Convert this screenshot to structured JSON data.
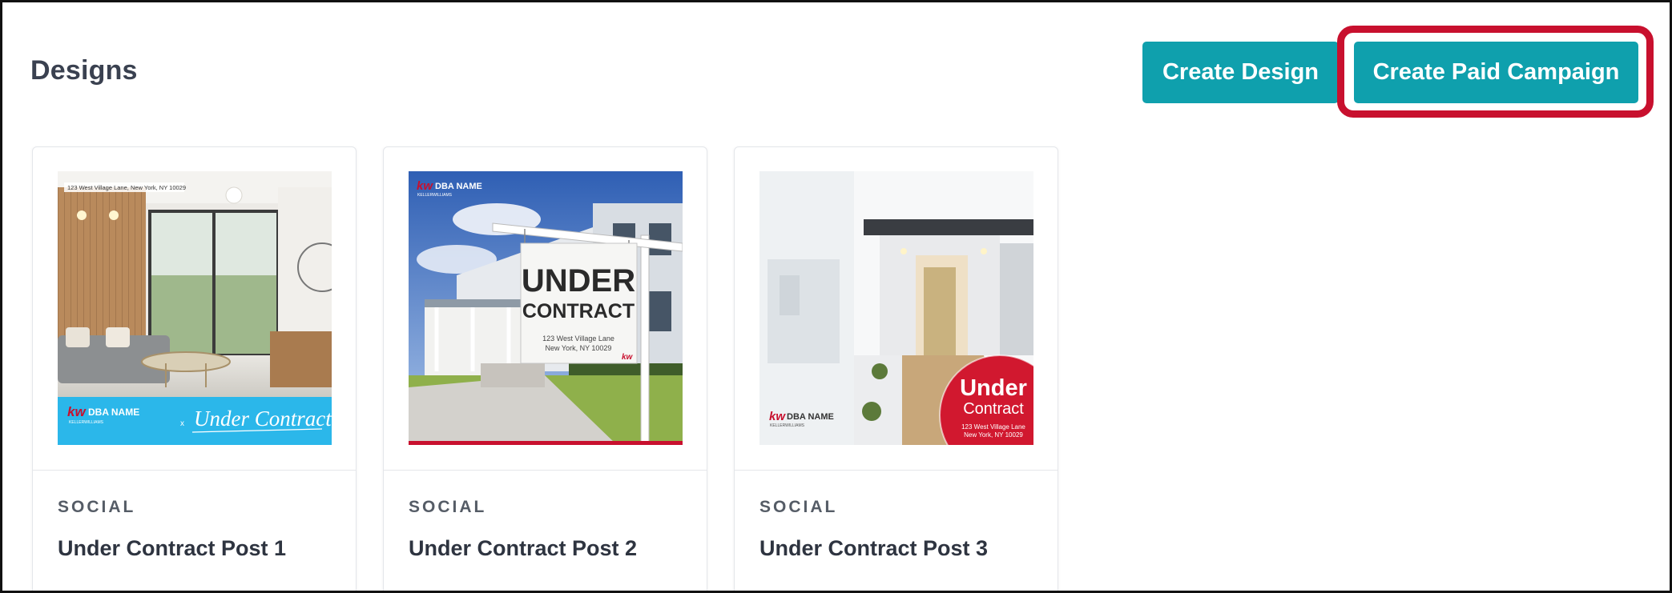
{
  "page": {
    "title": "Designs"
  },
  "toolbar": {
    "create_design_label": "Create Design",
    "create_paid_campaign_label": "Create Paid Campaign"
  },
  "colors": {
    "button": "#0fa0ad",
    "highlight": "#c8102e",
    "brand_red": "#c8102e",
    "banner_blue": "#2bb7ea"
  },
  "designs": [
    {
      "type": "SOCIAL",
      "name": "Under Contract Post 1",
      "thumbnail": {
        "address": "123 West Village Lane, New York, NY 10029",
        "brand": "DBA NAME",
        "brand_sub": "KELLERWILLIAMS",
        "headline": "Under Contract",
        "separator": "x"
      }
    },
    {
      "type": "SOCIAL",
      "name": "Under Contract Post 2",
      "thumbnail": {
        "brand": "DBA NAME",
        "brand_sub": "KELLERWILLIAMS",
        "sign_line1": "UNDER",
        "sign_line2": "CONTRACT",
        "address_line1": "123 West Village Lane",
        "address_line2": "New York, NY 10029",
        "sign_logo": "kw"
      }
    },
    {
      "type": "SOCIAL",
      "name": "Under Contract Post 3",
      "thumbnail": {
        "brand": "DBA NAME",
        "brand_sub": "KELLERWILLIAMS",
        "badge_line1": "Under",
        "badge_line2": "Contract",
        "address_line1": "123 West Village Lane",
        "address_line2": "New York, NY 10029"
      }
    }
  ]
}
